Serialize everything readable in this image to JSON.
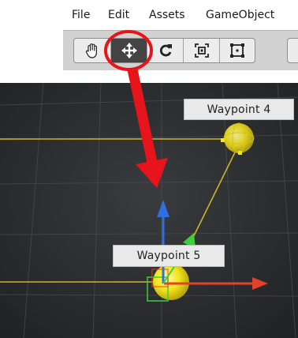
{
  "menu": {
    "items": [
      "File",
      "Edit",
      "Assets",
      "GameObject"
    ]
  },
  "toolbar": {
    "tools": [
      {
        "name": "hand-tool",
        "icon": "hand-icon"
      },
      {
        "name": "move-tool",
        "icon": "move-arrows-icon",
        "active": true
      },
      {
        "name": "rotate-tool",
        "icon": "rotate-icon"
      },
      {
        "name": "scale-tool",
        "icon": "scale-icon"
      },
      {
        "name": "rect-tool",
        "icon": "rect-transform-icon"
      }
    ]
  },
  "scene": {
    "waypoints": [
      {
        "label": "Waypoint 4"
      },
      {
        "label": "Waypoint 5"
      }
    ]
  },
  "annotation": {
    "highlight_color": "#e8141c",
    "arrow_color": "#e8141c"
  },
  "colors": {
    "scene_bg": "#2a2b2d",
    "waypoint_line": "#c8b530",
    "waypoint_sphere": "#f2e21a",
    "axis_x": "#e0432a",
    "axis_y": "#2f6fe0",
    "axis_z": "#3ccf3c"
  }
}
